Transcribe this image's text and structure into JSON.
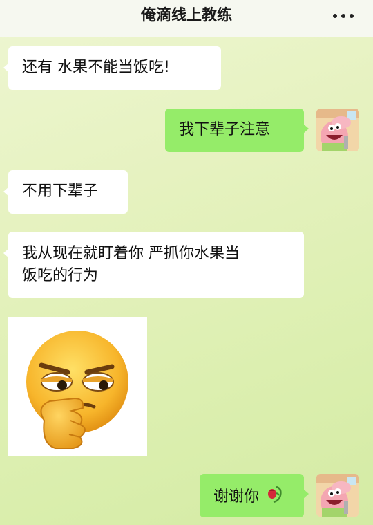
{
  "header": {
    "title": "俺滴线上教练",
    "more_icon": "more-dots-icon"
  },
  "messages": [
    {
      "side": "left",
      "text": "还有  水果不能当饭吃!"
    },
    {
      "side": "right",
      "text": "我下辈子注意"
    },
    {
      "side": "left",
      "text": "不用下辈子"
    },
    {
      "side": "left",
      "line1": "我从现在就盯着你  严抓你水果当",
      "line2": "饭吃的行为"
    },
    {
      "side": "left",
      "sticker": "thinking-face-sticker"
    },
    {
      "side": "right",
      "text": "谢谢你",
      "emoji": "wilted-rose-icon"
    }
  ],
  "colors": {
    "right_bubble": "#95ec69",
    "left_bubble": "#ffffff",
    "background": "#e4f1bf"
  }
}
